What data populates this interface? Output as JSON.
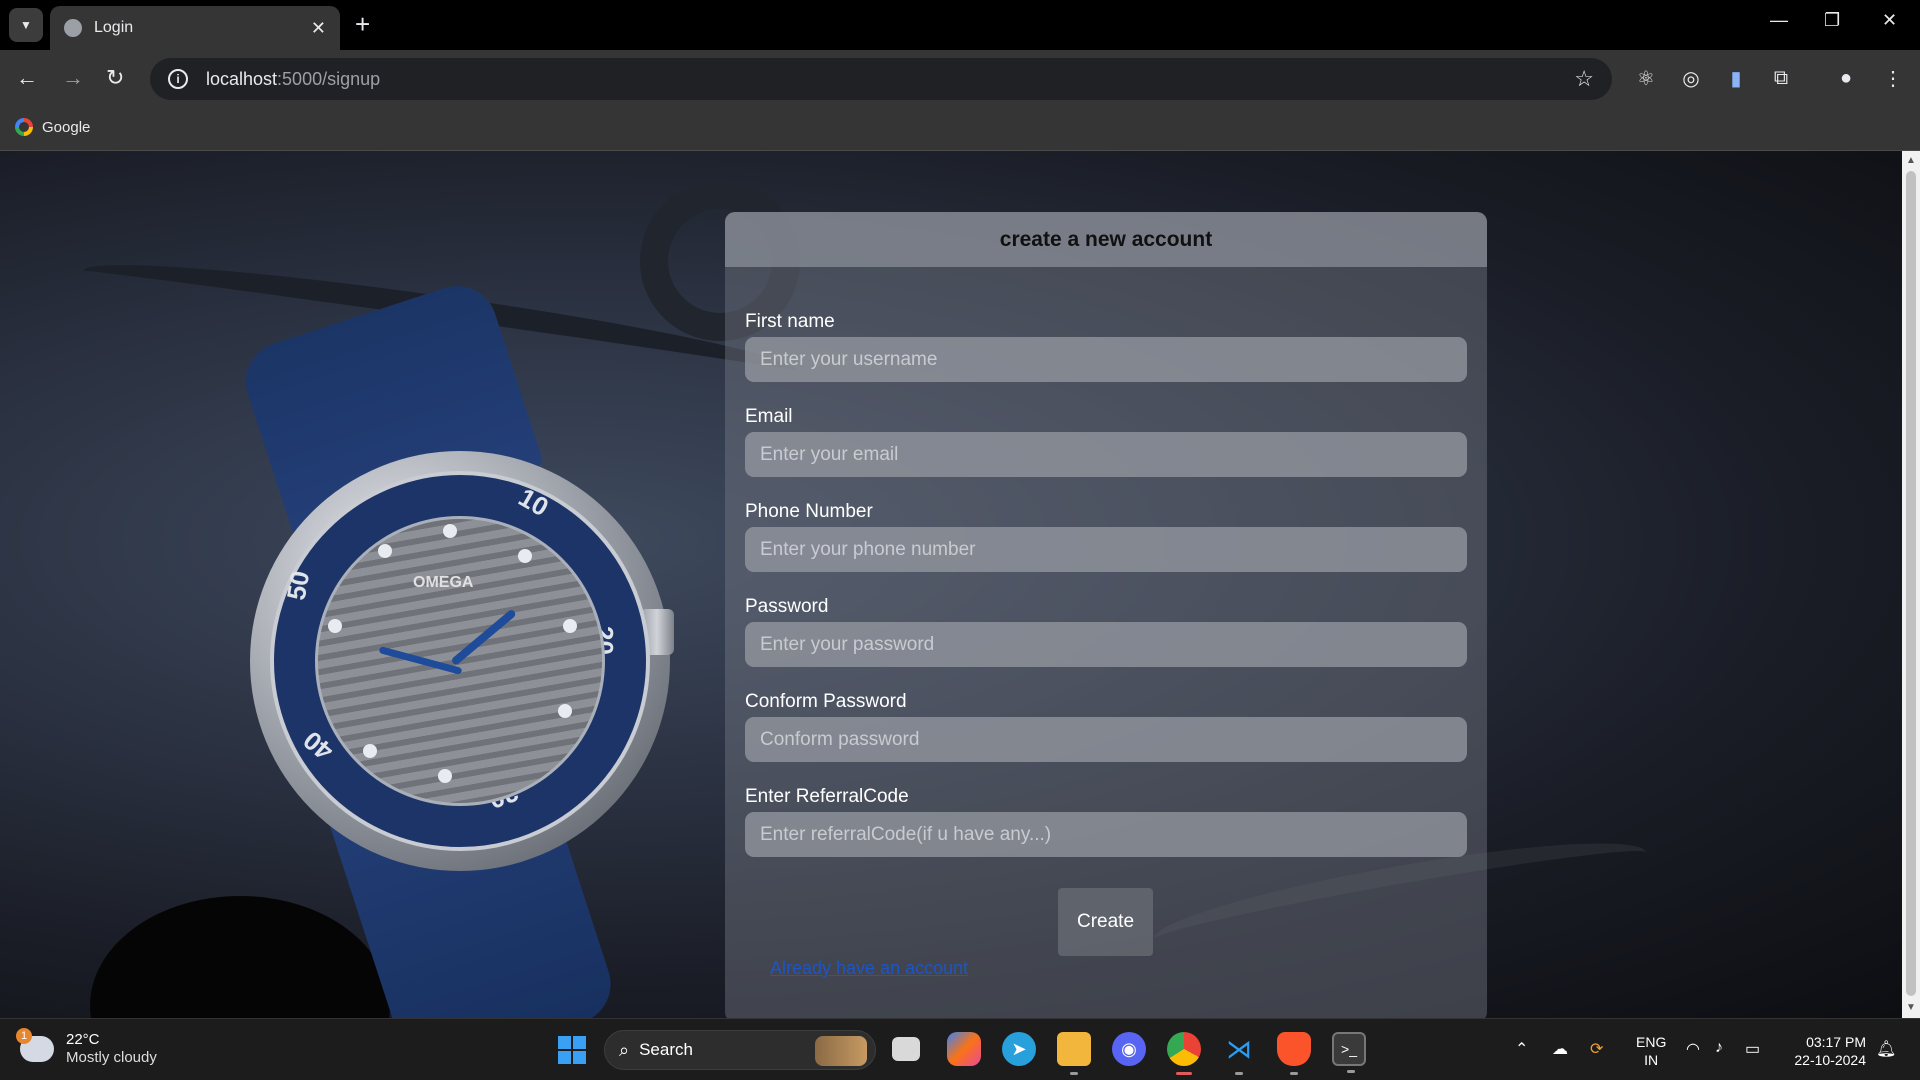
{
  "browser": {
    "tab_title": "Login",
    "new_tab": "+",
    "url_host": "localhost",
    "url_path": ":5000/signup",
    "bookmark_google": "Google",
    "window_controls": {
      "minimize": "—",
      "restore": "❐",
      "close": "✕"
    }
  },
  "form": {
    "heading": "create a new account",
    "fields": [
      {
        "label": "First name",
        "placeholder": "Enter your username"
      },
      {
        "label": "Email",
        "placeholder": "Enter your email"
      },
      {
        "label": "Phone Number",
        "placeholder": "Enter your phone number"
      },
      {
        "label": "Password",
        "placeholder": "Enter your password"
      },
      {
        "label": "Conform Password",
        "placeholder": "Conform password"
      },
      {
        "label": "Enter ReferralCode",
        "placeholder": "Enter referralCode(if u have any...)"
      }
    ],
    "submit_label": "Create",
    "login_link": "Already have an account"
  },
  "watch": {
    "brand": "OMEGA",
    "bezel_numbers": [
      "10",
      "20",
      "30",
      "40",
      "50"
    ]
  },
  "taskbar": {
    "weather_badge": "1",
    "weather_temp": "22°C",
    "weather_condition": "Mostly cloudy",
    "search_label": "Search",
    "lang_line1": "ENG",
    "lang_line2": "IN",
    "time": "03:17 PM",
    "date": "22-10-2024"
  },
  "colors": {
    "link": "#1a56c9",
    "accent_blue": "#3aa0f3",
    "active_indicator": "#e05b5b"
  }
}
